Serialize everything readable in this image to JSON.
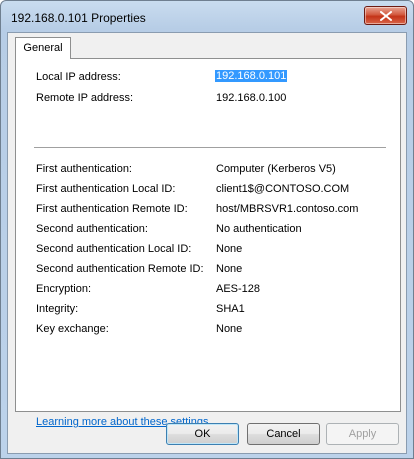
{
  "window": {
    "title": "192.168.0.101 Properties"
  },
  "tabs": [
    {
      "label": "General"
    }
  ],
  "addresses": [
    {
      "label": "Local IP address:",
      "value": "192.168.0.101"
    },
    {
      "label": "Remote IP address:",
      "value": "192.168.0.100"
    }
  ],
  "properties": [
    {
      "label": "First authentication:",
      "value": "Computer (Kerberos V5)"
    },
    {
      "label": "First authentication Local ID:",
      "value": "client1$@CONTOSO.COM"
    },
    {
      "label": "First authentication Remote ID:",
      "value": "host/MBRSVR1.contoso.com"
    },
    {
      "label": "Second authentication:",
      "value": "No authentication"
    },
    {
      "label": "Second authentication Local ID:",
      "value": "None"
    },
    {
      "label": "Second authentication Remote ID:",
      "value": "None"
    },
    {
      "label": "Encryption:",
      "value": "AES-128"
    },
    {
      "label": "Integrity:",
      "value": "SHA1"
    },
    {
      "label": "Key exchange:",
      "value": "None"
    }
  ],
  "link": {
    "label": "Learning more about these settings"
  },
  "buttons": {
    "ok": "OK",
    "cancel": "Cancel",
    "apply": "Apply"
  },
  "icons": {
    "close": "close-icon"
  },
  "colors": {
    "selection": "#3399ff",
    "link": "#0066cc",
    "close_button": "#c43318"
  }
}
